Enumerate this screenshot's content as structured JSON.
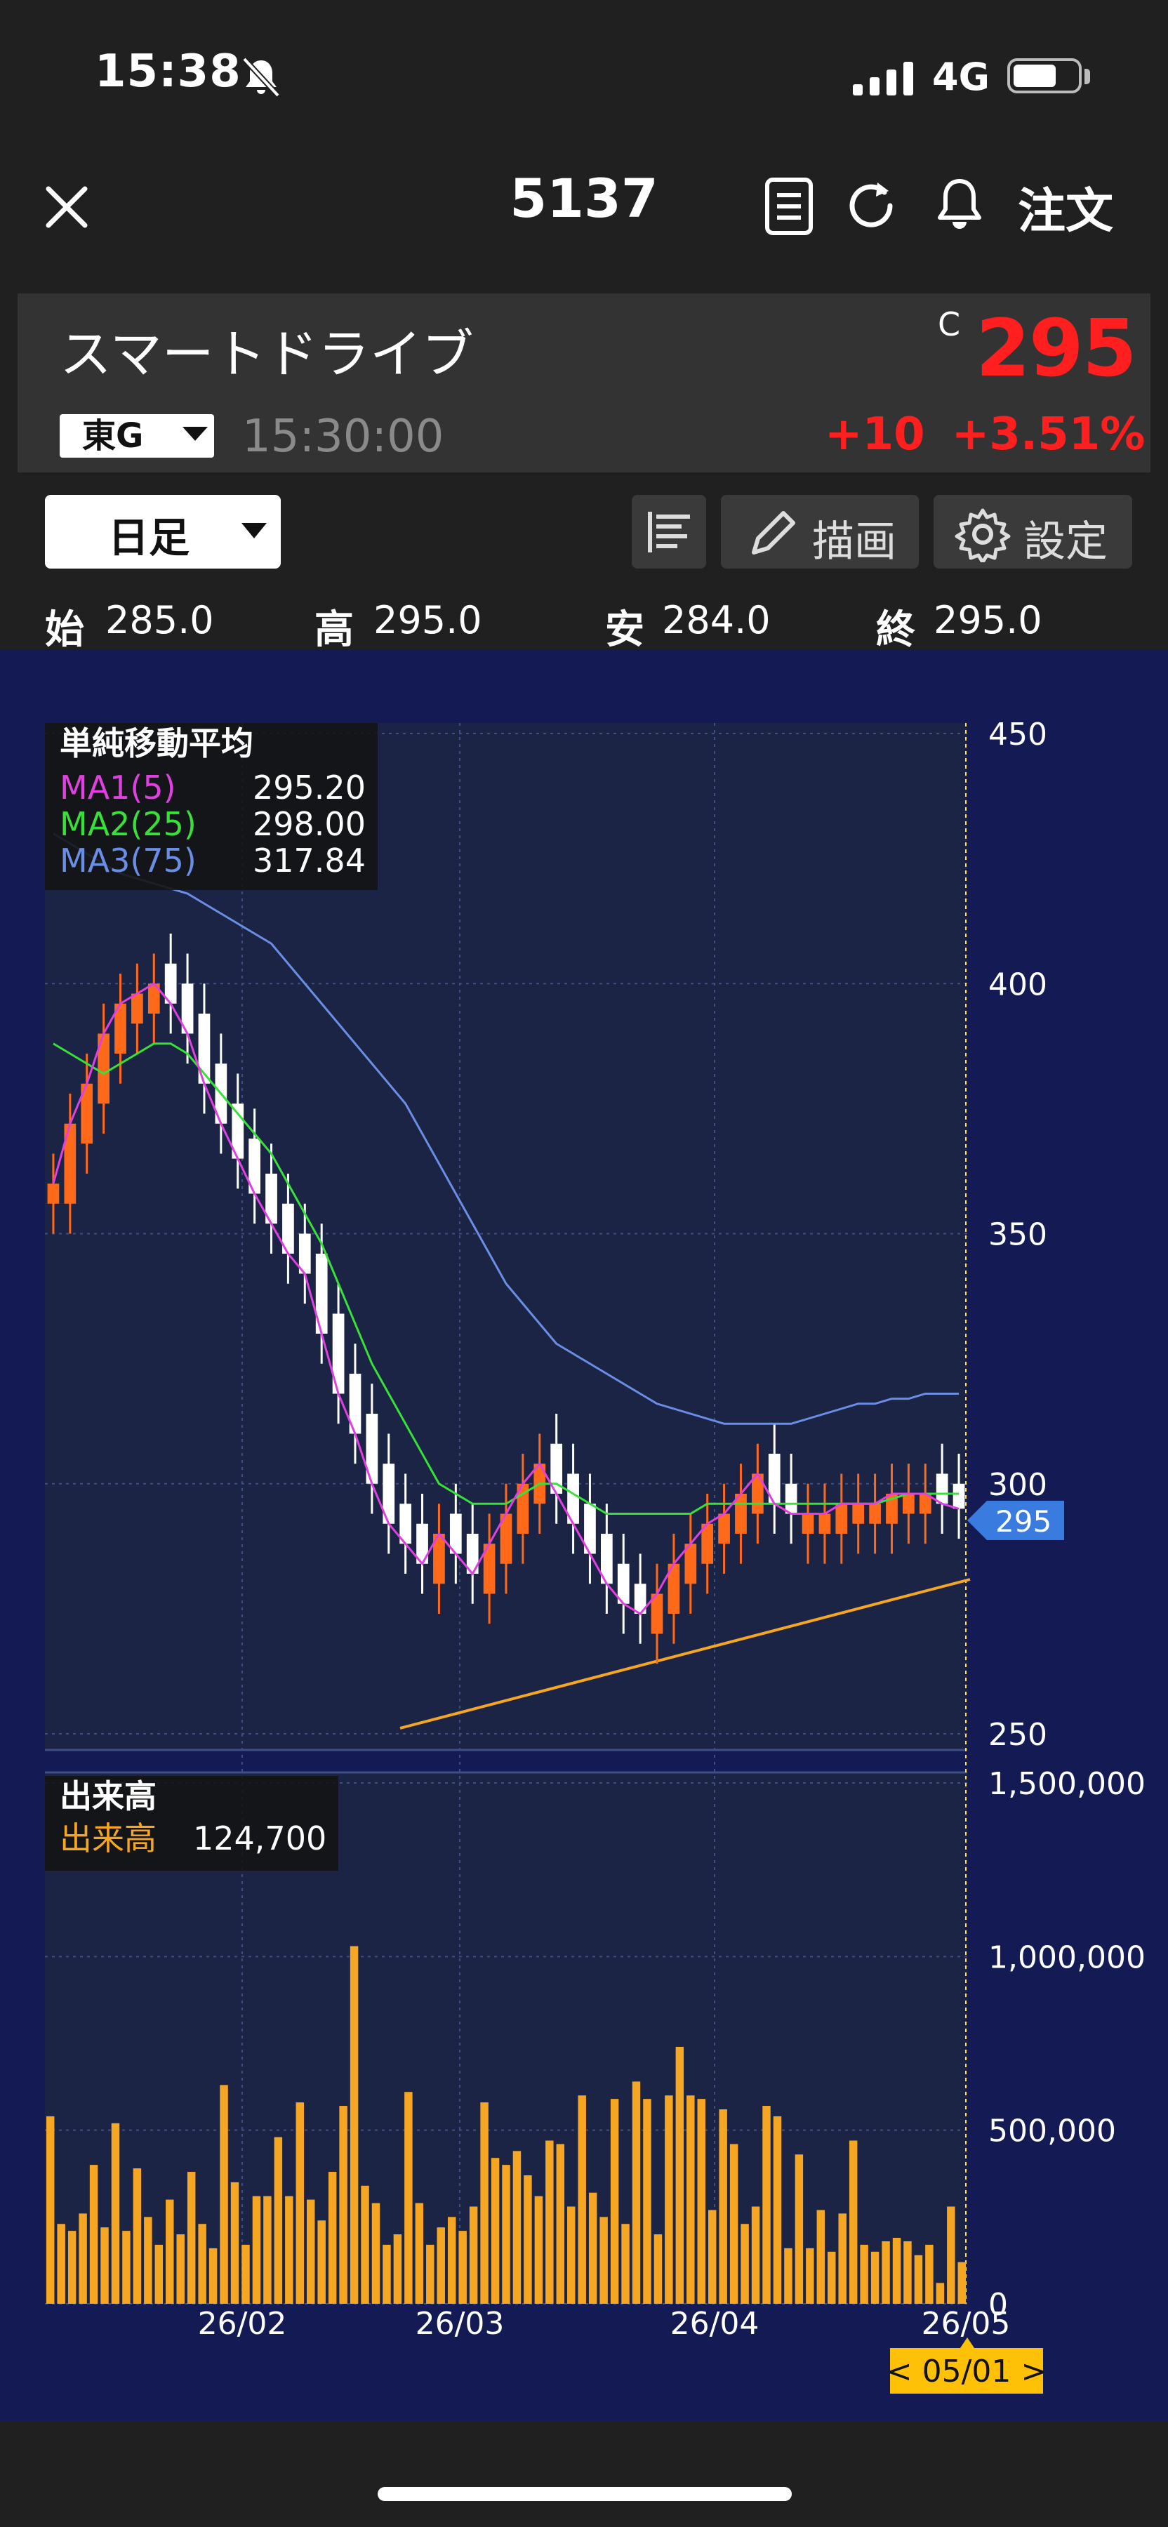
{
  "status_bar": {
    "time": "15:38",
    "network": "4G",
    "icons": [
      "bell-off-icon",
      "signal-icon",
      "battery-icon"
    ]
  },
  "header": {
    "symbol": "5137",
    "order_label": "注文",
    "icons": [
      "close-icon",
      "document-icon",
      "refresh-icon",
      "bell-icon"
    ]
  },
  "quote": {
    "name": "スマートドライブ",
    "market": "東G",
    "time": "15:30:00",
    "c_label": "C",
    "price": "295",
    "change": "+10",
    "change_pct": "+3.51%",
    "colors": {
      "up": "#ff1f1f"
    }
  },
  "toolbar": {
    "period": "日足",
    "draw_label": "描画",
    "settings_label": "設定"
  },
  "ohlc": {
    "open_label": "始",
    "open": "285.0",
    "high_label": "高",
    "high": "295.0",
    "low_label": "安",
    "low": "284.0",
    "close_label": "終",
    "close": "295.0"
  },
  "chart_data": [
    {
      "type": "candlestick",
      "legend_title": "単純移動平均",
      "series": [
        {
          "name": "MA1(5)",
          "last": "295.20",
          "color": "#e040e0"
        },
        {
          "name": "MA2(25)",
          "last": "298.00",
          "color": "#39e039"
        },
        {
          "name": "MA3(75)",
          "last": "317.84",
          "color": "#6a8ee6"
        }
      ],
      "y_ticks": [
        "450",
        "400",
        "350",
        "300",
        "250"
      ],
      "ylim": [
        250,
        450
      ],
      "current_price_tag": "295",
      "ma1": [
        360,
        372,
        380,
        390,
        396,
        398,
        400,
        396,
        390,
        380,
        372,
        365,
        358,
        352,
        346,
        342,
        330,
        318,
        310,
        300,
        292,
        288,
        284,
        290,
        286,
        282,
        288,
        294,
        300,
        304,
        298,
        292,
        286,
        280,
        276,
        274,
        278,
        284,
        288,
        292,
        294,
        298,
        302,
        296,
        294,
        294,
        294,
        296,
        296,
        296,
        298,
        298,
        298,
        296,
        295
      ],
      "ma2": [
        388,
        386,
        384,
        382,
        384,
        386,
        388,
        388,
        386,
        382,
        378,
        374,
        370,
        366,
        360,
        354,
        348,
        340,
        332,
        324,
        318,
        312,
        306,
        300,
        298,
        296,
        296,
        296,
        298,
        300,
        300,
        298,
        296,
        294,
        294,
        294,
        294,
        294,
        294,
        296,
        296,
        296,
        296,
        296,
        296,
        296,
        296,
        296,
        296,
        296,
        297,
        298,
        298,
        298,
        298
      ],
      "ma3": [
        430,
        428,
        426,
        424,
        422,
        421,
        420,
        419,
        418,
        416,
        414,
        412,
        410,
        408,
        404,
        400,
        396,
        392,
        388,
        384,
        380,
        376,
        370,
        364,
        358,
        352,
        346,
        340,
        336,
        332,
        328,
        326,
        324,
        322,
        320,
        318,
        316,
        315,
        314,
        313,
        312,
        312,
        312,
        312,
        312,
        313,
        314,
        315,
        316,
        316,
        317,
        317,
        318,
        318,
        318
      ]
    },
    {
      "type": "bar",
      "legend_title": "出来高",
      "series": [
        {
          "name": "出来高",
          "last": "124,700",
          "color": "#f5a623"
        }
      ],
      "y_ticks": [
        "1,500,000",
        "1,000,000",
        "500,000",
        "0"
      ],
      "ylim": [
        0,
        1500000
      ],
      "x_ticks": [
        "26/02",
        "26/03",
        "26/04",
        "26/05"
      ],
      "current_date_tag": "< 05/01 >",
      "values": [
        540000,
        230000,
        210000,
        260000,
        400000,
        220000,
        520000,
        210000,
        390000,
        250000,
        170000,
        300000,
        200000,
        380000,
        230000,
        160000,
        630000,
        350000,
        170000,
        310000,
        310000,
        480000,
        310000,
        580000,
        300000,
        240000,
        380000,
        570000,
        1030000,
        340000,
        290000,
        170000,
        200000,
        610000,
        290000,
        170000,
        220000,
        250000,
        210000,
        280000,
        580000,
        420000,
        400000,
        440000,
        370000,
        310000,
        470000,
        460000,
        280000,
        600000,
        320000,
        250000,
        590000,
        230000,
        640000,
        590000,
        200000,
        600000,
        740000,
        600000,
        590000,
        270000,
        560000,
        460000,
        230000,
        280000,
        570000,
        540000,
        160000,
        430000,
        160000,
        270000,
        150000,
        260000,
        470000,
        170000,
        150000,
        180000,
        190000,
        180000,
        140000,
        170000,
        60000,
        280000,
        120000
      ]
    }
  ]
}
